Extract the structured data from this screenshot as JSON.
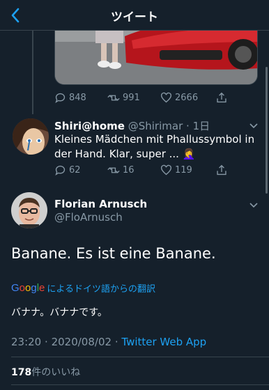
{
  "header": {
    "title": "ツイート",
    "back_icon": "chevron-left-icon"
  },
  "prev_tweet": {
    "replies": "848",
    "retweets": "991",
    "likes": "2666"
  },
  "reply_tweet": {
    "name": "Shiri@home",
    "handle": "@Shirimar",
    "separator": "·",
    "time": "1日",
    "text_line1": "Kleines Mädchen mit Phallussymbol in",
    "text_line2": "der Hand. Klar, super ...",
    "emoji": "🤦‍♀️",
    "replies": "62",
    "retweets": "16",
    "likes": "119"
  },
  "main_tweet": {
    "name": "Florian Arnusch",
    "handle": "@FloArnusch",
    "text": "Banane. Es ist eine Banane.",
    "translate_brand": "Google",
    "translate_label": "によるドイツ語からの翻訳",
    "translated_text": "バナナ。バナナです。",
    "time": "23:20",
    "dot": "·",
    "date": "2020/08/02",
    "via": "Twitter Web App",
    "likes_count": "178",
    "likes_label": "件のいいね"
  },
  "colors": {
    "background": "#15202b",
    "accent": "#1da1f2",
    "muted": "#8899a6",
    "border": "#38444d"
  }
}
